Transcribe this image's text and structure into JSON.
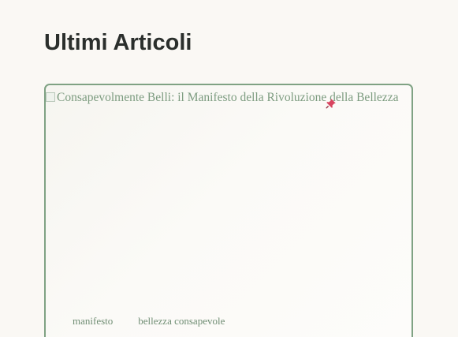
{
  "section": {
    "title": "Ultimi Articoli"
  },
  "article": {
    "image_alt": "Consapevolmente Belli: il Manifesto della Rivoluzione della Bellezza",
    "pin_icon": "pushpin-icon",
    "tags": [
      "manifesto",
      "bellezza consapevole"
    ]
  },
  "colors": {
    "accent_border": "#7fa283",
    "text_green": "#7d9c80",
    "heading": "#2b2f2c",
    "pin": "#d8445f",
    "background": "#faf8f4"
  }
}
